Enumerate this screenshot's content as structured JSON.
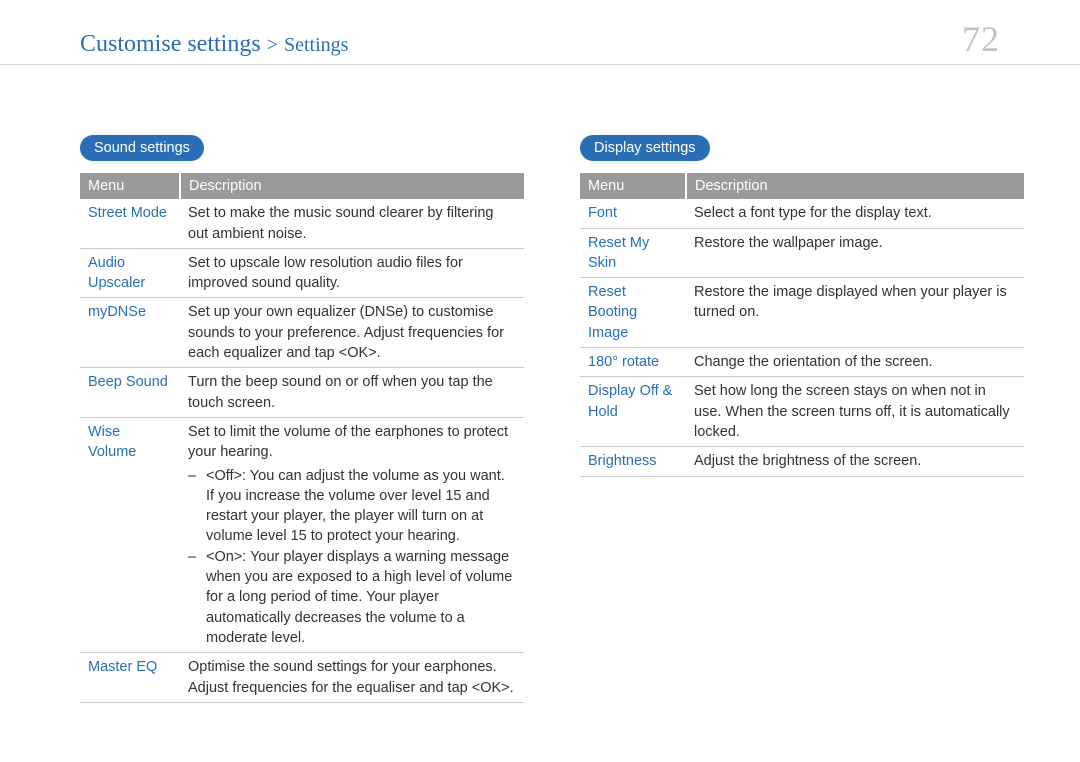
{
  "header": {
    "breadcrumb_1": "Customise settings",
    "breadcrumb_sep": ">",
    "breadcrumb_2": "Settings",
    "page_number": "72"
  },
  "sound": {
    "title": "Sound settings",
    "cols": {
      "menu": "Menu",
      "desc": "Description"
    },
    "rows": {
      "street_mode": {
        "menu": "Street Mode",
        "desc": "Set to make the music sound clearer by filtering out ambient noise."
      },
      "audio_upscaler": {
        "menu": "Audio Upscaler",
        "desc": "Set to upscale low resolution audio files for improved sound quality."
      },
      "mydnse": {
        "menu": "myDNSe",
        "desc": "Set up your own equalizer (DNSe) to customise sounds to your preference. Adjust frequencies for each equalizer and tap <OK>."
      },
      "beep_sound": {
        "menu": "Beep Sound",
        "desc": "Turn the beep sound on or off when you tap the touch screen."
      },
      "wise_volume": {
        "menu": "Wise Volume",
        "intro": "Set to limit the volume of the earphones to protect your hearing.",
        "off": "<Off>: You can adjust the volume as you want. If you increase the volume over level 15 and restart your player, the player will turn on at volume level 15 to protect your hearing.",
        "on": "<On>: Your player displays a warning message when you are exposed to a high level of volume for a long period of time. Your player automatically decreases the volume to a moderate level."
      },
      "master_eq": {
        "menu": "Master EQ",
        "desc": "Optimise the sound settings for your earphones. Adjust frequencies for the equaliser and tap <OK>."
      }
    }
  },
  "display": {
    "title": "Display settings",
    "cols": {
      "menu": "Menu",
      "desc": "Description"
    },
    "rows": {
      "font": {
        "menu": "Font",
        "desc": "Select a font type for the display text."
      },
      "reset_skin": {
        "menu": "Reset My Skin",
        "desc": "Restore the wallpaper image."
      },
      "reset_boot": {
        "menu": "Reset Booting Image",
        "desc": "Restore the image displayed when your player is turned on."
      },
      "rotate": {
        "menu": "180° rotate",
        "desc": "Change the orientation of the screen."
      },
      "display_off": {
        "menu": "Display Off & Hold",
        "desc": "Set how long the screen stays on when not in use. When the screen turns off, it is automatically locked."
      },
      "brightness": {
        "menu": "Brightness",
        "desc": "Adjust the brightness of the screen."
      }
    }
  }
}
